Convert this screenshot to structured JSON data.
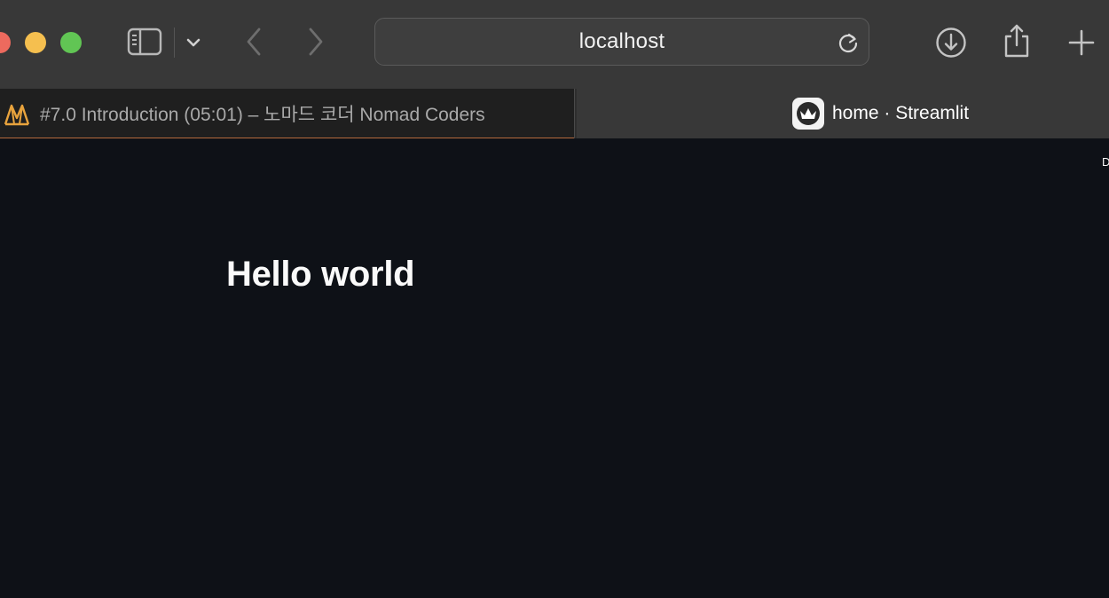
{
  "browser": {
    "address_text": "localhost",
    "tabs": [
      {
        "title": "#7.0 Introduction (05:01) – 노마드 코더 Nomad Coders",
        "active": false,
        "favicon": "nomad-coders-logo"
      },
      {
        "title": "home · Streamlit",
        "active": true,
        "favicon": "streamlit-crown-logo"
      }
    ],
    "toolbar_icons": [
      "sidebar-icon",
      "chevron-down-icon",
      "back-icon",
      "forward-icon",
      "reload-icon",
      "download-icon",
      "share-icon",
      "new-tab-icon"
    ],
    "colors": {
      "toolbar_bg": "#383838",
      "tab_inactive_bg": "#1f1f1f",
      "traffic_close": "#ed6a5e",
      "traffic_minimize": "#f5bf4f",
      "traffic_maximize": "#61c554",
      "nomad_accent": "#e8a33d"
    }
  },
  "page": {
    "heading": "Hello world",
    "corner_text": "D",
    "background": "#0e1117",
    "text_color": "#fafafa"
  }
}
